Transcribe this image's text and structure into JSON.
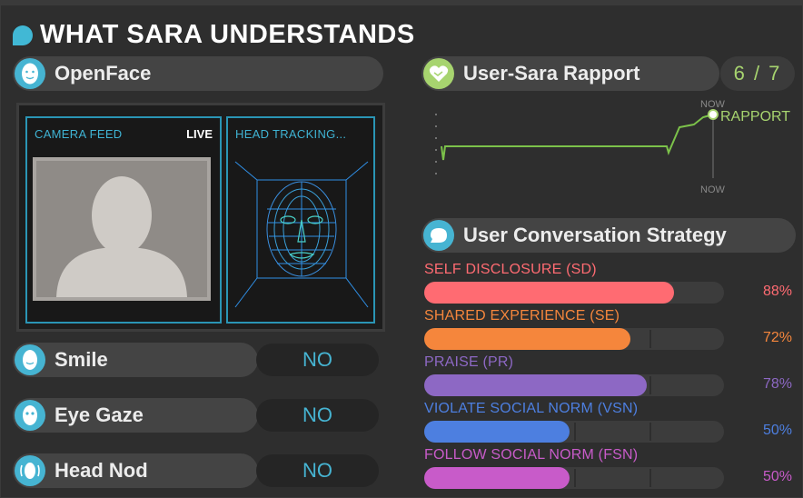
{
  "header": {
    "title": "WHAT SARA UNDERSTANDS"
  },
  "openface": {
    "title": "OpenFace",
    "camera_label": "CAMERA FEED",
    "live_label": "LIVE",
    "tracking_label": "HEAD TRACKING..."
  },
  "features": [
    {
      "label": "Smile",
      "value": "NO",
      "icon": "face-icon"
    },
    {
      "label": "Eye Gaze",
      "value": "NO",
      "icon": "eye-face-icon"
    },
    {
      "label": "Head Nod",
      "value": "NO",
      "icon": "head-nod-icon"
    }
  ],
  "rapport": {
    "title": "User-Sara Rapport",
    "score": "6 / 7",
    "now_top": "NOW",
    "now_bottom": "NOW",
    "series_label": "RAPPORT",
    "color": "#a7d46f"
  },
  "strategy": {
    "title": "User Conversation Strategy",
    "items": [
      {
        "label": "SELF DISCLOSURE (SD)",
        "percent": "88%",
        "value": 88,
        "color": "#ff6b72"
      },
      {
        "label": "SHARED EXPERIENCE (SE)",
        "percent": "72%",
        "value": 72,
        "color": "#f5863c"
      },
      {
        "label": "PRAISE (PR)",
        "percent": "78%",
        "value": 78,
        "color": "#8d68c4"
      },
      {
        "label": "VIOLATE SOCIAL NORM (VSN)",
        "percent": "50%",
        "value": 50,
        "color": "#4d7fe0"
      },
      {
        "label": "FOLLOW SOCIAL NORM (FSN)",
        "percent": "50%",
        "value": 50,
        "color": "#c85bc9"
      }
    ]
  }
}
